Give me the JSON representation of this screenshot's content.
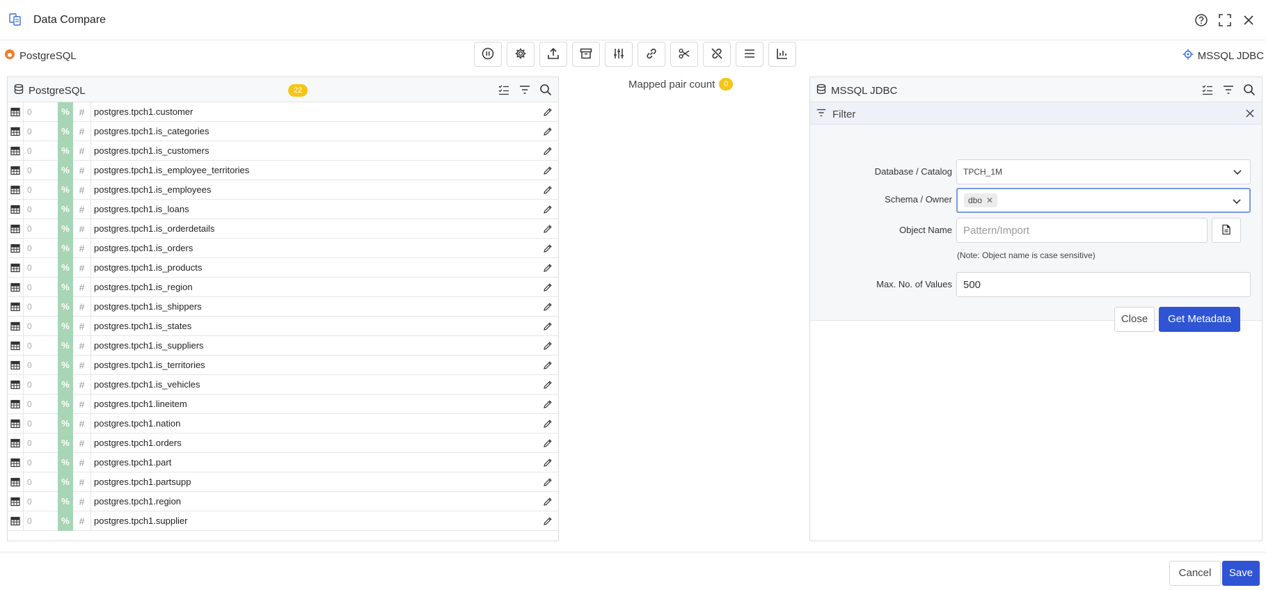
{
  "window": {
    "title": "Data Compare"
  },
  "toolbar": {
    "source_label": "PostgreSQL",
    "target_label": "MSSQL JDBC",
    "buttons": [
      "pause-icon",
      "gear-icon",
      "upload-icon",
      "archive-icon",
      "sliders-icon",
      "link-icon",
      "scissors-icon",
      "unlink-icon",
      "menu-icon",
      "chart-icon"
    ]
  },
  "left_panel": {
    "title": "PostgreSQL",
    "count": "22",
    "rows": [
      {
        "num": "0",
        "pct": "%",
        "hash": "#",
        "name": "postgres.tpch1.customer"
      },
      {
        "num": "0",
        "pct": "%",
        "hash": "#",
        "name": "postgres.tpch1.is_categories"
      },
      {
        "num": "0",
        "pct": "%",
        "hash": "#",
        "name": "postgres.tpch1.is_customers"
      },
      {
        "num": "0",
        "pct": "%",
        "hash": "#",
        "name": "postgres.tpch1.is_employee_territories"
      },
      {
        "num": "0",
        "pct": "%",
        "hash": "#",
        "name": "postgres.tpch1.is_employees"
      },
      {
        "num": "0",
        "pct": "%",
        "hash": "#",
        "name": "postgres.tpch1.is_loans"
      },
      {
        "num": "0",
        "pct": "%",
        "hash": "#",
        "name": "postgres.tpch1.is_orderdetails"
      },
      {
        "num": "0",
        "pct": "%",
        "hash": "#",
        "name": "postgres.tpch1.is_orders"
      },
      {
        "num": "0",
        "pct": "%",
        "hash": "#",
        "name": "postgres.tpch1.is_products"
      },
      {
        "num": "0",
        "pct": "%",
        "hash": "#",
        "name": "postgres.tpch1.is_region"
      },
      {
        "num": "0",
        "pct": "%",
        "hash": "#",
        "name": "postgres.tpch1.is_shippers"
      },
      {
        "num": "0",
        "pct": "%",
        "hash": "#",
        "name": "postgres.tpch1.is_states"
      },
      {
        "num": "0",
        "pct": "%",
        "hash": "#",
        "name": "postgres.tpch1.is_suppliers"
      },
      {
        "num": "0",
        "pct": "%",
        "hash": "#",
        "name": "postgres.tpch1.is_territories"
      },
      {
        "num": "0",
        "pct": "%",
        "hash": "#",
        "name": "postgres.tpch1.is_vehicles"
      },
      {
        "num": "0",
        "pct": "%",
        "hash": "#",
        "name": "postgres.tpch1.lineitem"
      },
      {
        "num": "0",
        "pct": "%",
        "hash": "#",
        "name": "postgres.tpch1.nation"
      },
      {
        "num": "0",
        "pct": "%",
        "hash": "#",
        "name": "postgres.tpch1.orders"
      },
      {
        "num": "0",
        "pct": "%",
        "hash": "#",
        "name": "postgres.tpch1.part"
      },
      {
        "num": "0",
        "pct": "%",
        "hash": "#",
        "name": "postgres.tpch1.partsupp"
      },
      {
        "num": "0",
        "pct": "%",
        "hash": "#",
        "name": "postgres.tpch1.region"
      },
      {
        "num": "0",
        "pct": "%",
        "hash": "#",
        "name": "postgres.tpch1.supplier"
      }
    ]
  },
  "mapping": {
    "label": "Mapped pair count",
    "count": "0"
  },
  "right_panel": {
    "title": "MSSQL JDBC",
    "filter": {
      "title": "Filter",
      "database_label": "Database / Catalog",
      "database_value": "TPCH_1M",
      "schema_label": "Schema / Owner",
      "schema_chip": "dbo",
      "object_label": "Object Name",
      "object_placeholder": "Pattern/Import",
      "note": "(Note: Object name is case sensitive)",
      "max_label": "Max. No. of Values",
      "max_value": "500",
      "close_label": "Close",
      "get_metadata_label": "Get Metadata"
    }
  },
  "footer": {
    "cancel_label": "Cancel",
    "save_label": "Save"
  },
  "colors": {
    "primary": "#2f54d4",
    "badge": "#f5c518",
    "pct_cell": "#a8d5b5",
    "pg_icon": "#f07c2a"
  }
}
